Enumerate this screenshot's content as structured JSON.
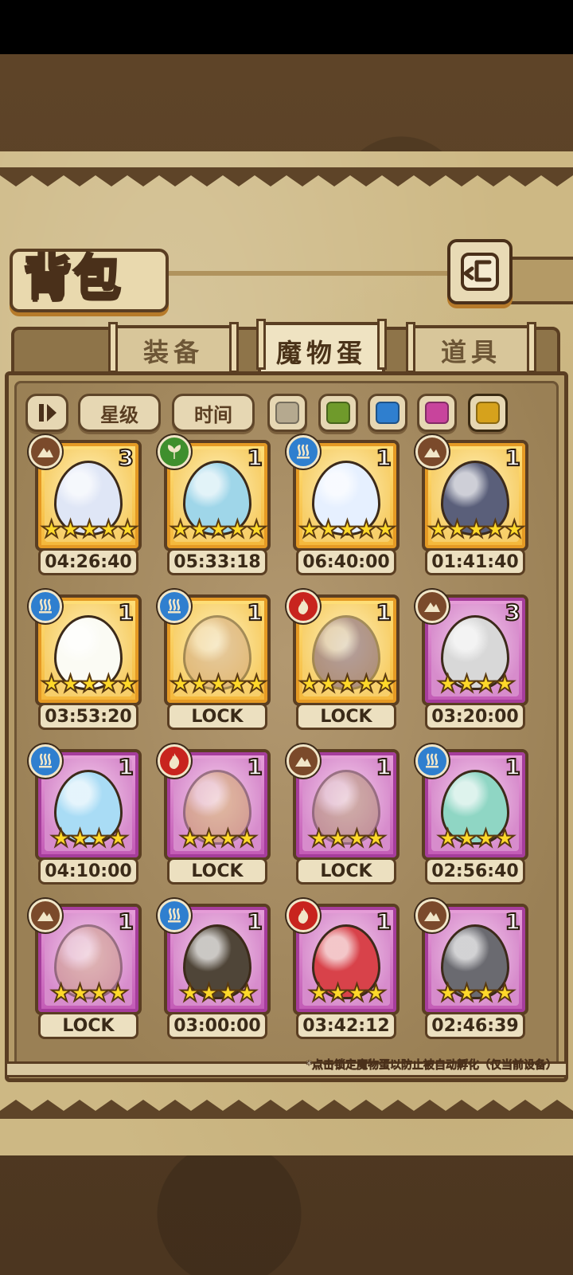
{
  "header": {
    "title": "背包"
  },
  "tabs": [
    {
      "label": "装备",
      "active": false
    },
    {
      "label": "魔物蛋",
      "active": true
    },
    {
      "label": "道具",
      "active": false
    }
  ],
  "filters": {
    "sort_label": "星级",
    "time_label": "时间",
    "colors": [
      "#b5a98f",
      "#6f9a2b",
      "#2f7fcf",
      "#c8449c",
      "#d6a21c"
    ]
  },
  "eggs": [
    {
      "element": "earth-icon",
      "count": "3",
      "stars": "★★★★★",
      "timer": "04:26:40",
      "frame": "gold",
      "egg_color": "#dfe6f6"
    },
    {
      "element": "grass-icon",
      "count": "1",
      "stars": "★★★★★",
      "timer": "05:33:18",
      "frame": "gold",
      "egg_color": "#9fd6e9"
    },
    {
      "element": "water-icon",
      "count": "1",
      "stars": "★★★★★",
      "timer": "06:40:00",
      "frame": "gold",
      "egg_color": "#e6f0ff"
    },
    {
      "element": "earth-icon",
      "count": "1",
      "stars": "★★★★★",
      "timer": "01:41:40",
      "frame": "gold",
      "egg_color": "#5a5f7a"
    },
    {
      "element": "water-icon",
      "count": "1",
      "stars": "★★★★★",
      "timer": "03:53:20",
      "frame": "gold",
      "egg_color": "#fbfbf4"
    },
    {
      "element": "water-icon",
      "count": "1",
      "stars": "★★★★★",
      "timer": "LOCK",
      "frame": "gold",
      "egg_color": "#c99c7a"
    },
    {
      "element": "fire-icon",
      "count": "1",
      "stars": "★★★★★",
      "timer": "LOCK",
      "frame": "gold",
      "egg_color": "#5a3e7a"
    },
    {
      "element": "earth-icon",
      "count": "3",
      "stars": "★★★★",
      "timer": "03:20:00",
      "frame": "purple",
      "egg_color": "#d8d8d8"
    },
    {
      "element": "water-icon",
      "count": "1",
      "stars": "★★★★",
      "timer": "04:10:00",
      "frame": "purple",
      "egg_color": "#a9dcf5"
    },
    {
      "element": "fire-icon",
      "count": "1",
      "stars": "★★★★",
      "timer": "LOCK",
      "frame": "purple",
      "egg_color": "#c9a34a"
    },
    {
      "element": "earth-icon",
      "count": "1",
      "stars": "★★★★",
      "timer": "LOCK",
      "frame": "purple",
      "egg_color": "#a58a5a"
    },
    {
      "element": "water-icon",
      "count": "1",
      "stars": "★★★★",
      "timer": "02:56:40",
      "frame": "purple",
      "egg_color": "#8fd6c4"
    },
    {
      "element": "earth-icon",
      "count": "1",
      "stars": "★★★★",
      "timer": "LOCK",
      "frame": "purple",
      "egg_color": "#c79a74"
    },
    {
      "element": "water-icon",
      "count": "1",
      "stars": "★★★★",
      "timer": "03:00:00",
      "frame": "purple",
      "egg_color": "#4f4538"
    },
    {
      "element": "fire-icon",
      "count": "1",
      "stars": "★★★★",
      "timer": "03:42:12",
      "frame": "purple",
      "egg_color": "#d8424a"
    },
    {
      "element": "earth-icon",
      "count": "1",
      "stars": "★★★★",
      "timer": "02:46:39",
      "frame": "purple",
      "egg_color": "#6a6a70"
    }
  ],
  "footnote": "*点击锁定魔物蛋以防止被自动孵化（仅当前设备）"
}
